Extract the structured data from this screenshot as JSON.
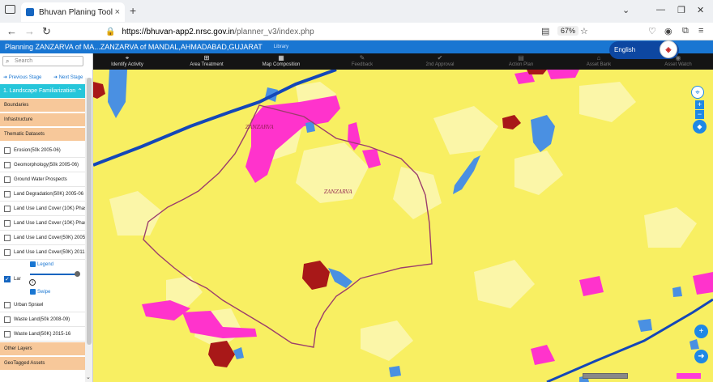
{
  "browser": {
    "tab_title": "Bhuvan Planing Tool",
    "tab_close": "×",
    "new_tab": "+",
    "url_domain": "https://bhuvan-app2.nrsc.gov.in",
    "url_path": "/planner_v3/index.php",
    "zoom": "67%"
  },
  "header": {
    "title": "Planning ZANZARVA of MA...ZANZARVA of MANDAL,AHMADABAD,GUJARAT",
    "sub": "Library",
    "language": "English"
  },
  "toolbar": [
    {
      "label": "Identify Activity",
      "icon": "marker-icon",
      "glyph": "⌖",
      "dim": false
    },
    {
      "label": "Area Treatment",
      "icon": "plus-box-icon",
      "glyph": "⊞",
      "dim": false
    },
    {
      "label": "Map Composition",
      "icon": "map-icon",
      "glyph": "▦",
      "dim": false
    },
    {
      "label": "Feedback",
      "icon": "feedback-icon",
      "glyph": "✎",
      "dim": true
    },
    {
      "label": "2nd Approval",
      "icon": "approval-icon",
      "glyph": "✔",
      "dim": true
    },
    {
      "label": "Action Plan",
      "icon": "plan-icon",
      "glyph": "▤",
      "dim": true
    },
    {
      "label": "Asset Bank",
      "icon": "bank-icon",
      "glyph": "⌂",
      "dim": true
    },
    {
      "label": "Asset Watch",
      "icon": "eye-icon",
      "glyph": "◉",
      "dim": true
    }
  ],
  "sidebar": {
    "search_placeholder": "Search",
    "prev_stage": "Previous Stage",
    "next_stage": "Next Stage",
    "current_stage": "1. Landscape Familiarization",
    "sections": {
      "boundaries": "Boundaries",
      "infrastructure": "Infrastructure",
      "thematic": "Thematic Datasets",
      "other": "Other Layers",
      "geotagged": "GeoTagged Assets"
    },
    "layers_top": [
      "Erosion(50k 2005-06)",
      "Geomorphology(50k 2005-06)",
      "Ground Water Prospects",
      "Land Degradation(50K) 2005-06",
      "Land Use Land Cover (10K) Phase",
      "Land Use Land Cover (10K) Phase",
      "Land Use Land Cover(50K) 2005-0",
      "Land Use Land Cover(50K) 2011-1"
    ],
    "active_layer": "Lar",
    "legend_link": "Legend",
    "swipe_link": "Swipe",
    "layers_bottom": [
      "Urban Sprawl",
      "Waste Land(50k 2008-09)",
      "Waste Land(50K) 2015-16"
    ]
  },
  "map": {
    "village_labels": [
      "ZANZARVA",
      "ZANZARVA"
    ],
    "colors": {
      "base": "#f8ef62",
      "built_up": "#ff33cc",
      "water": "#4a90e2",
      "fallow": "#fbf6a8",
      "red_patch": "#a81818",
      "boundary": "#9c3d6c",
      "road": "#1447b8"
    },
    "zoom_in": "+",
    "zoom_out": "−"
  }
}
